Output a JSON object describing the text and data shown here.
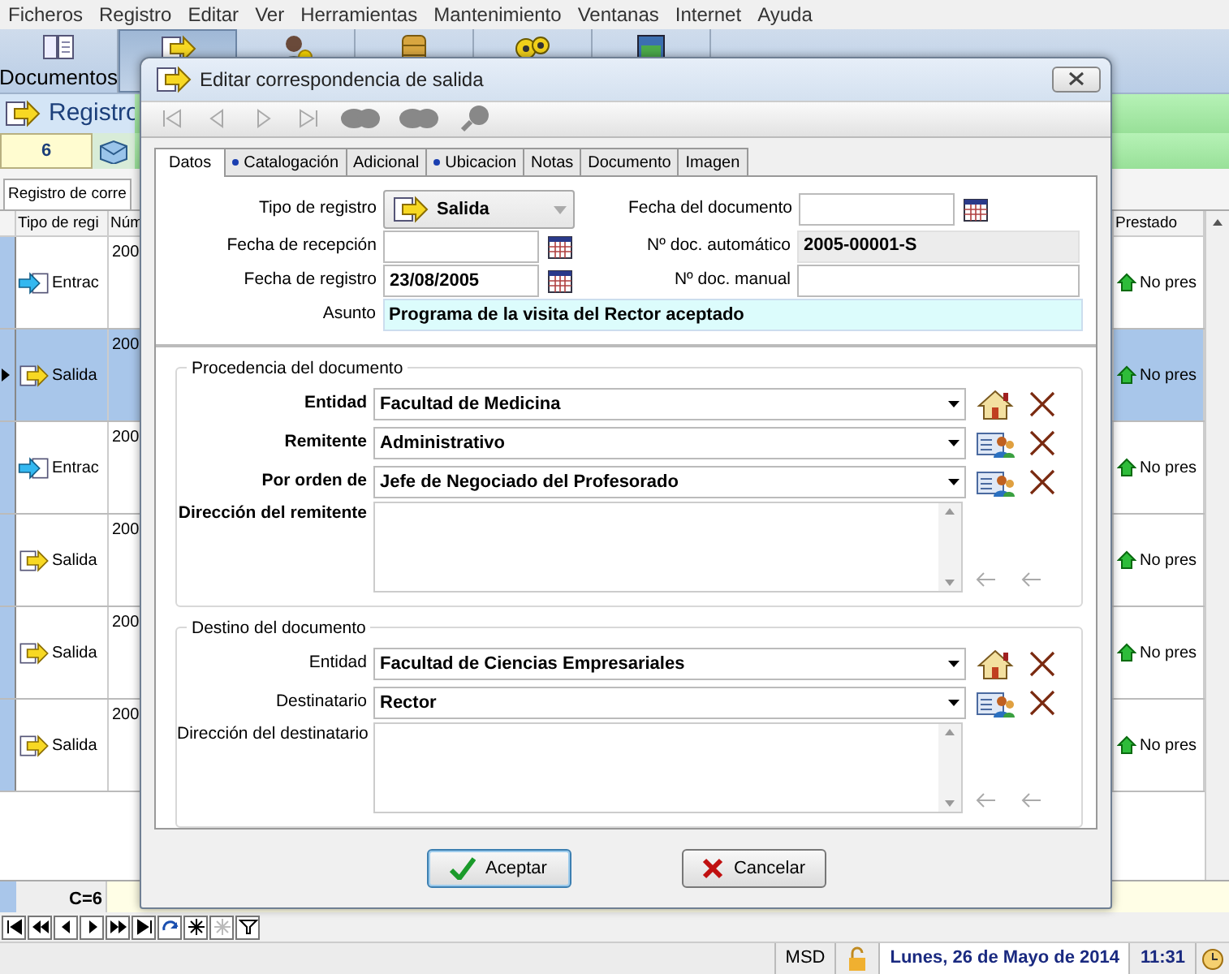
{
  "menu": [
    "Ficheros",
    "Registro",
    "Editar",
    "Ver",
    "Herramientas",
    "Mantenimiento",
    "Ventanas",
    "Internet",
    "Ayuda"
  ],
  "toolbar": [
    {
      "kind": "documents",
      "label": "Documentos",
      "selected": false
    },
    {
      "kind": "outgoing",
      "selected": true
    },
    {
      "kind": "person",
      "selected": false
    },
    {
      "kind": "database",
      "selected": false
    },
    {
      "kind": "gears",
      "selected": false
    },
    {
      "kind": "window",
      "selected": false
    }
  ],
  "section": {
    "title": "Registro",
    "counter": "6"
  },
  "grid_tab": "Registro de corre",
  "table": {
    "columns": [
      "Tipo de regi",
      "Núm",
      "Prestado"
    ],
    "rows": [
      {
        "kind": "incoming",
        "type": "Entrac",
        "number": "200",
        "loan": "No pres",
        "selected": false
      },
      {
        "kind": "outgoing",
        "type": "Salida",
        "number": "200",
        "loan": "No pres",
        "selected": true
      },
      {
        "kind": "incoming",
        "type": "Entrac",
        "number": "200",
        "loan": "No pres",
        "selected": false
      },
      {
        "kind": "outgoing",
        "type": "Salida",
        "number": "200",
        "loan": "No pres",
        "selected": false
      },
      {
        "kind": "outgoing",
        "type": "Salida",
        "number": "200",
        "loan": "No pres",
        "selected": false
      },
      {
        "kind": "outgoing",
        "type": "Salida",
        "number": "200",
        "loan": "No pres",
        "selected": false
      }
    ],
    "footer": "C=6"
  },
  "status_bar": {
    "user": "MSD",
    "date": "Lunes, 26 de Mayo de 2014",
    "time": "11:31"
  },
  "dialog": {
    "title": "Editar correspondencia de salida",
    "tabs": [
      {
        "label": "Datos",
        "selected": true,
        "marked": false
      },
      {
        "label": "Catalogación",
        "selected": false,
        "marked": true
      },
      {
        "label": "Adicional",
        "selected": false,
        "marked": false
      },
      {
        "label": "Ubicacion",
        "selected": false,
        "marked": true
      },
      {
        "label": "Notas",
        "selected": false,
        "marked": false
      },
      {
        "label": "Documento",
        "selected": false,
        "marked": false
      },
      {
        "label": "Imagen",
        "selected": false,
        "marked": false
      }
    ],
    "record_type": {
      "label": "Tipo de registro",
      "value": "Salida"
    },
    "reception_date": {
      "label": "Fecha de recepción"
    },
    "register_date": {
      "label": "Fecha de registro",
      "value": "23/08/2005"
    },
    "document_date": {
      "label": "Fecha del documento"
    },
    "auto_number": {
      "label": "Nº doc. automático",
      "value": "2005-00001-S"
    },
    "manual_number": {
      "label": "Nº doc. manual"
    },
    "subject": {
      "label": "Asunto",
      "value": "Programa de la visita del Rector aceptado"
    },
    "groups": [
      {
        "title": "Procedencia del documento",
        "fields": [
          {
            "label": "Entidad",
            "value": "Facultad de Medicina",
            "kind": "entity",
            "required": true
          },
          {
            "label": "Remitente",
            "value": "Administrativo",
            "kind": "person",
            "required": true
          },
          {
            "label": "Por orden de",
            "value": "Jefe de Negociado del Profesorado",
            "kind": "person",
            "required": true
          }
        ],
        "address_label": "Dirección del remitente",
        "address_required": true
      },
      {
        "title": "Destino del documento",
        "fields": [
          {
            "label": "Entidad",
            "value": "Facultad de Ciencias Empresariales",
            "kind": "entity",
            "required": false
          },
          {
            "label": "Destinatario",
            "value": "Rector",
            "kind": "person",
            "required": false
          }
        ],
        "address_label": "Dirección del destinatario",
        "address_required": false
      }
    ],
    "buttons": [
      {
        "label": "Aceptar",
        "kind": "ok"
      },
      {
        "label": "Cancelar",
        "kind": "cancel"
      }
    ]
  }
}
